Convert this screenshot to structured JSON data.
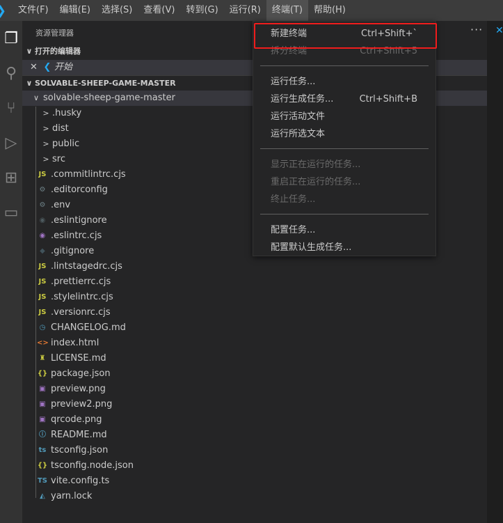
{
  "menubar": {
    "items": [
      "文件(F)",
      "编辑(E)",
      "选择(S)",
      "查看(V)",
      "转到(G)",
      "运行(R)",
      "终端(T)",
      "帮助(H)"
    ],
    "active_index": 6
  },
  "sidebar": {
    "title": "资源管理器",
    "more": "···",
    "open_editors": {
      "label": "打开的编辑器",
      "items": [
        {
          "name": "开始"
        }
      ]
    },
    "workspace": "SOLVABLE-SHEEP-GAME-MASTER",
    "root_folder": "solvable-sheep-game-master",
    "folders": [
      ".husky",
      "dist",
      "public",
      "src"
    ],
    "files": [
      {
        "name": ".commitlintrc.cjs",
        "icon": "js-icon",
        "glyph": "JS",
        "color": "#cbcb41"
      },
      {
        "name": ".editorconfig",
        "icon": "gear-icon",
        "glyph": "⚙",
        "color": "#6d8086"
      },
      {
        "name": ".env",
        "icon": "gear-icon",
        "glyph": "⚙",
        "color": "#6d8086"
      },
      {
        "name": ".eslintignore",
        "icon": "eslint-icon",
        "glyph": "◉",
        "color": "#4d5a5e"
      },
      {
        "name": ".eslintrc.cjs",
        "icon": "eslint-icon",
        "glyph": "◉",
        "color": "#a074c4"
      },
      {
        "name": ".gitignore",
        "icon": "git-icon",
        "glyph": "◆",
        "color": "#41535b"
      },
      {
        "name": ".lintstagedrc.cjs",
        "icon": "js-icon",
        "glyph": "JS",
        "color": "#cbcb41"
      },
      {
        "name": ".prettierrc.cjs",
        "icon": "js-icon",
        "glyph": "JS",
        "color": "#cbcb41"
      },
      {
        "name": ".stylelintrc.cjs",
        "icon": "js-icon",
        "glyph": "JS",
        "color": "#cbcb41"
      },
      {
        "name": ".versionrc.cjs",
        "icon": "js-icon",
        "glyph": "JS",
        "color": "#cbcb41"
      },
      {
        "name": "CHANGELOG.md",
        "icon": "clock-icon",
        "glyph": "◷",
        "color": "#519aba"
      },
      {
        "name": "index.html",
        "icon": "html-icon",
        "glyph": "<>",
        "color": "#e37933"
      },
      {
        "name": "LICENSE.md",
        "icon": "license-icon",
        "glyph": "♜",
        "color": "#cbcb41"
      },
      {
        "name": "package.json",
        "icon": "json-icon",
        "glyph": "{}",
        "color": "#cbcb41"
      },
      {
        "name": "preview.png",
        "icon": "image-icon",
        "glyph": "▣",
        "color": "#a074c4"
      },
      {
        "name": "preview2.png",
        "icon": "image-icon",
        "glyph": "▣",
        "color": "#a074c4"
      },
      {
        "name": "qrcode.png",
        "icon": "image-icon",
        "glyph": "▣",
        "color": "#a074c4"
      },
      {
        "name": "README.md",
        "icon": "info-icon",
        "glyph": "ⓘ",
        "color": "#519aba"
      },
      {
        "name": "tsconfig.json",
        "icon": "tsconfig-icon",
        "glyph": "ts",
        "color": "#519aba"
      },
      {
        "name": "tsconfig.node.json",
        "icon": "json-icon",
        "glyph": "{}",
        "color": "#cbcb41"
      },
      {
        "name": "vite.config.ts",
        "icon": "ts-icon",
        "glyph": "TS",
        "color": "#519aba"
      },
      {
        "name": "yarn.lock",
        "icon": "yarn-icon",
        "glyph": "◭",
        "color": "#519aba"
      }
    ]
  },
  "terminal_menu": {
    "groups": [
      [
        {
          "label": "新建终端",
          "shortcut": "Ctrl+Shift+`",
          "disabled": false,
          "highlighted": true
        },
        {
          "label": "拆分终端",
          "shortcut": "Ctrl+Shift+5",
          "disabled": true
        }
      ],
      [
        {
          "label": "运行任务...",
          "shortcut": "",
          "disabled": false
        },
        {
          "label": "运行生成任务...",
          "shortcut": "Ctrl+Shift+B",
          "disabled": false
        },
        {
          "label": "运行活动文件",
          "shortcut": "",
          "disabled": false
        },
        {
          "label": "运行所选文本",
          "shortcut": "",
          "disabled": false
        }
      ],
      [
        {
          "label": "显示正在运行的任务...",
          "shortcut": "",
          "disabled": true
        },
        {
          "label": "重启正在运行的任务...",
          "shortcut": "",
          "disabled": true
        },
        {
          "label": "终止任务...",
          "shortcut": "",
          "disabled": true
        }
      ],
      [
        {
          "label": "配置任务...",
          "shortcut": "",
          "disabled": false
        },
        {
          "label": "配置默认生成任务...",
          "shortcut": "",
          "disabled": false
        }
      ]
    ]
  },
  "colors": {
    "accent": "#23a9f2",
    "highlight_box": "#f01c1c"
  }
}
